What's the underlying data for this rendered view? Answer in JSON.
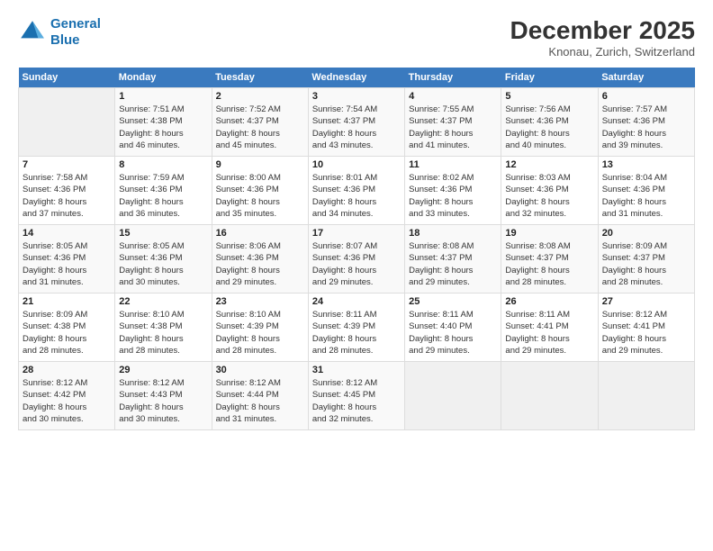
{
  "logo": {
    "line1": "General",
    "line2": "Blue"
  },
  "title": "December 2025",
  "subtitle": "Knonau, Zurich, Switzerland",
  "headers": [
    "Sunday",
    "Monday",
    "Tuesday",
    "Wednesday",
    "Thursday",
    "Friday",
    "Saturday"
  ],
  "weeks": [
    [
      {
        "day": "",
        "info": ""
      },
      {
        "day": "1",
        "info": "Sunrise: 7:51 AM\nSunset: 4:38 PM\nDaylight: 8 hours\nand 46 minutes."
      },
      {
        "day": "2",
        "info": "Sunrise: 7:52 AM\nSunset: 4:37 PM\nDaylight: 8 hours\nand 45 minutes."
      },
      {
        "day": "3",
        "info": "Sunrise: 7:54 AM\nSunset: 4:37 PM\nDaylight: 8 hours\nand 43 minutes."
      },
      {
        "day": "4",
        "info": "Sunrise: 7:55 AM\nSunset: 4:37 PM\nDaylight: 8 hours\nand 41 minutes."
      },
      {
        "day": "5",
        "info": "Sunrise: 7:56 AM\nSunset: 4:36 PM\nDaylight: 8 hours\nand 40 minutes."
      },
      {
        "day": "6",
        "info": "Sunrise: 7:57 AM\nSunset: 4:36 PM\nDaylight: 8 hours\nand 39 minutes."
      }
    ],
    [
      {
        "day": "7",
        "info": "Sunrise: 7:58 AM\nSunset: 4:36 PM\nDaylight: 8 hours\nand 37 minutes."
      },
      {
        "day": "8",
        "info": "Sunrise: 7:59 AM\nSunset: 4:36 PM\nDaylight: 8 hours\nand 36 minutes."
      },
      {
        "day": "9",
        "info": "Sunrise: 8:00 AM\nSunset: 4:36 PM\nDaylight: 8 hours\nand 35 minutes."
      },
      {
        "day": "10",
        "info": "Sunrise: 8:01 AM\nSunset: 4:36 PM\nDaylight: 8 hours\nand 34 minutes."
      },
      {
        "day": "11",
        "info": "Sunrise: 8:02 AM\nSunset: 4:36 PM\nDaylight: 8 hours\nand 33 minutes."
      },
      {
        "day": "12",
        "info": "Sunrise: 8:03 AM\nSunset: 4:36 PM\nDaylight: 8 hours\nand 32 minutes."
      },
      {
        "day": "13",
        "info": "Sunrise: 8:04 AM\nSunset: 4:36 PM\nDaylight: 8 hours\nand 31 minutes."
      }
    ],
    [
      {
        "day": "14",
        "info": "Sunrise: 8:05 AM\nSunset: 4:36 PM\nDaylight: 8 hours\nand 31 minutes."
      },
      {
        "day": "15",
        "info": "Sunrise: 8:05 AM\nSunset: 4:36 PM\nDaylight: 8 hours\nand 30 minutes."
      },
      {
        "day": "16",
        "info": "Sunrise: 8:06 AM\nSunset: 4:36 PM\nDaylight: 8 hours\nand 29 minutes."
      },
      {
        "day": "17",
        "info": "Sunrise: 8:07 AM\nSunset: 4:36 PM\nDaylight: 8 hours\nand 29 minutes."
      },
      {
        "day": "18",
        "info": "Sunrise: 8:08 AM\nSunset: 4:37 PM\nDaylight: 8 hours\nand 29 minutes."
      },
      {
        "day": "19",
        "info": "Sunrise: 8:08 AM\nSunset: 4:37 PM\nDaylight: 8 hours\nand 28 minutes."
      },
      {
        "day": "20",
        "info": "Sunrise: 8:09 AM\nSunset: 4:37 PM\nDaylight: 8 hours\nand 28 minutes."
      }
    ],
    [
      {
        "day": "21",
        "info": "Sunrise: 8:09 AM\nSunset: 4:38 PM\nDaylight: 8 hours\nand 28 minutes."
      },
      {
        "day": "22",
        "info": "Sunrise: 8:10 AM\nSunset: 4:38 PM\nDaylight: 8 hours\nand 28 minutes."
      },
      {
        "day": "23",
        "info": "Sunrise: 8:10 AM\nSunset: 4:39 PM\nDaylight: 8 hours\nand 28 minutes."
      },
      {
        "day": "24",
        "info": "Sunrise: 8:11 AM\nSunset: 4:39 PM\nDaylight: 8 hours\nand 28 minutes."
      },
      {
        "day": "25",
        "info": "Sunrise: 8:11 AM\nSunset: 4:40 PM\nDaylight: 8 hours\nand 29 minutes."
      },
      {
        "day": "26",
        "info": "Sunrise: 8:11 AM\nSunset: 4:41 PM\nDaylight: 8 hours\nand 29 minutes."
      },
      {
        "day": "27",
        "info": "Sunrise: 8:12 AM\nSunset: 4:41 PM\nDaylight: 8 hours\nand 29 minutes."
      }
    ],
    [
      {
        "day": "28",
        "info": "Sunrise: 8:12 AM\nSunset: 4:42 PM\nDaylight: 8 hours\nand 30 minutes."
      },
      {
        "day": "29",
        "info": "Sunrise: 8:12 AM\nSunset: 4:43 PM\nDaylight: 8 hours\nand 30 minutes."
      },
      {
        "day": "30",
        "info": "Sunrise: 8:12 AM\nSunset: 4:44 PM\nDaylight: 8 hours\nand 31 minutes."
      },
      {
        "day": "31",
        "info": "Sunrise: 8:12 AM\nSunset: 4:45 PM\nDaylight: 8 hours\nand 32 minutes."
      },
      {
        "day": "",
        "info": ""
      },
      {
        "day": "",
        "info": ""
      },
      {
        "day": "",
        "info": ""
      }
    ]
  ]
}
